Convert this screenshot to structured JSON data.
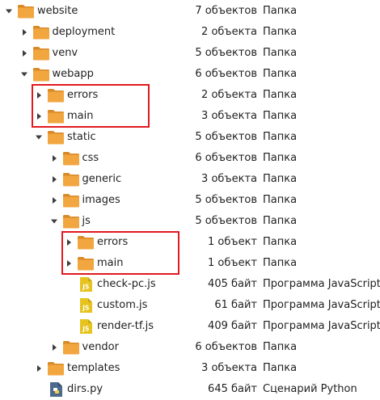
{
  "accent_folder_color": "#f2a640",
  "js_icon_color": "#e6c31e",
  "highlight_color": "#e0191f",
  "rows": [
    {
      "name": "website",
      "size": "7 объектов",
      "type": "Папка",
      "kind": "folder",
      "depth": 0,
      "expanded": true
    },
    {
      "name": "deployment",
      "size": "2 объекта",
      "type": "Папка",
      "kind": "folder",
      "depth": 1,
      "expanded": false
    },
    {
      "name": "venv",
      "size": "5 объектов",
      "type": "Папка",
      "kind": "folder",
      "depth": 1,
      "expanded": false
    },
    {
      "name": "webapp",
      "size": "6 объектов",
      "type": "Папка",
      "kind": "folder",
      "depth": 1,
      "expanded": true
    },
    {
      "name": "errors",
      "size": "2 объекта",
      "type": "Папка",
      "kind": "folder",
      "depth": 2,
      "expanded": false
    },
    {
      "name": "main",
      "size": "3 объекта",
      "type": "Папка",
      "kind": "folder",
      "depth": 2,
      "expanded": false
    },
    {
      "name": "static",
      "size": "5 объектов",
      "type": "Папка",
      "kind": "folder",
      "depth": 2,
      "expanded": true
    },
    {
      "name": "css",
      "size": "6 объектов",
      "type": "Папка",
      "kind": "folder",
      "depth": 3,
      "expanded": false
    },
    {
      "name": "generic",
      "size": "3 объекта",
      "type": "Папка",
      "kind": "folder",
      "depth": 3,
      "expanded": false
    },
    {
      "name": "images",
      "size": "5 объектов",
      "type": "Папка",
      "kind": "folder",
      "depth": 3,
      "expanded": false
    },
    {
      "name": "js",
      "size": "5 объектов",
      "type": "Папка",
      "kind": "folder",
      "depth": 3,
      "expanded": true
    },
    {
      "name": "errors",
      "size": "1 объект",
      "type": "Папка",
      "kind": "folder",
      "depth": 4,
      "expanded": false
    },
    {
      "name": "main",
      "size": "1 объект",
      "type": "Папка",
      "kind": "folder",
      "depth": 4,
      "expanded": false
    },
    {
      "name": "check-pc.js",
      "size": "405 байт",
      "type": "Программа JavaScript",
      "kind": "js",
      "depth": 4
    },
    {
      "name": "custom.js",
      "size": "61 байт",
      "type": "Программа JavaScript",
      "kind": "js",
      "depth": 4
    },
    {
      "name": "render-tf.js",
      "size": "409 байт",
      "type": "Программа JavaScript",
      "kind": "js",
      "depth": 4
    },
    {
      "name": "vendor",
      "size": "6 объектов",
      "type": "Папка",
      "kind": "folder",
      "depth": 3,
      "expanded": false
    },
    {
      "name": "templates",
      "size": "3 объекта",
      "type": "Папка",
      "kind": "folder",
      "depth": 2,
      "expanded": false
    },
    {
      "name": "dirs.py",
      "size": "645 байт",
      "type": "Сценарий Python",
      "kind": "python",
      "depth": 2
    }
  ],
  "highlight_groups": [
    [
      4,
      5
    ],
    [
      11,
      12
    ]
  ]
}
